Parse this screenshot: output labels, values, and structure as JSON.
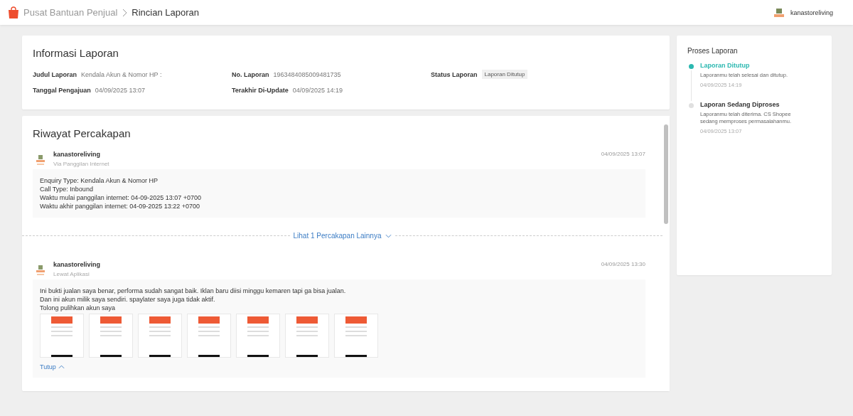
{
  "header": {
    "breadcrumb": [
      "Pusat Bantuan Penjual",
      "Rincian Laporan"
    ],
    "user": "kanastoreliving"
  },
  "info": {
    "title": "Informasi Laporan",
    "fields": [
      {
        "label": "Judul Laporan",
        "value": "Kendala Akun & Nomor HP :",
        "kind": "text"
      },
      {
        "label": "No. Laporan",
        "value": "1963484085009481735",
        "kind": "text"
      },
      {
        "label": "Status Laporan",
        "value": "Laporan Ditutup",
        "kind": "tag"
      },
      {
        "label": "Tanggal Pengajuan",
        "value": "04/09/2025 13:07",
        "kind": "text"
      },
      {
        "label": "Terakhir Di-Update",
        "value": "04/09/2025 14:19",
        "kind": "text"
      }
    ]
  },
  "conversation": {
    "title": "Riwayat Percakapan",
    "messages": [
      {
        "sender": "kanastoreliving",
        "channel": "Via Panggilan Internet",
        "time": "04/09/2025 13:07",
        "lines": [
          "Enquiry Type: Kendala Akun & Nomor HP",
          "Call Type: Inbound",
          "Waktu mulai panggilan internet: 04-09-2025 13:07 +0700",
          "Waktu akhir panggilan internet: 04-09-2025 13:22 +0700"
        ]
      },
      {
        "sender": "kanastoreliving",
        "channel": "Lewat Aplikasi",
        "time": "04/09/2025 13:30",
        "lines": [
          "Ini bukti jualan saya benar, performa sudah sangat baik. Iklan baru diisi minggu kemaren tapi ga bisa jualan.",
          "Dan ini akun milik saya sendiri. spaylater saya juga tidak aktif.",
          "Tolong pulihkan akun saya"
        ],
        "attachments": [
          {
            "kind": "image"
          },
          {
            "kind": "image"
          },
          {
            "kind": "image"
          },
          {
            "kind": "image"
          },
          {
            "kind": "image"
          },
          {
            "kind": "image"
          },
          {
            "kind": "image"
          }
        ],
        "collapse": "Tutup"
      }
    ],
    "more_link": "Lihat 1 Percakapan Lainnya"
  },
  "process": {
    "title": "Proses Laporan",
    "steps": [
      {
        "title": "Laporan Ditutup",
        "text": "Laporanmu telah selesai dan ditutup.",
        "time": "04/09/2025 14:19",
        "active": true
      },
      {
        "title": "Laporan Sedang Diproses",
        "text": "Laporanmu telah diterima. CS Shopee sedang memproses permasalahanmu.",
        "time": "04/09/2025 13:07",
        "active": false
      }
    ]
  }
}
